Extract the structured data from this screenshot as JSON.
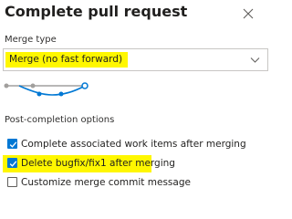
{
  "dialog": {
    "title": "Complete pull request",
    "close_icon": "close-icon"
  },
  "merge_type": {
    "label": "Merge type",
    "selected": "Merge (no fast forward)",
    "dropdown_icon": "chevron-down-icon",
    "highlight_color": "#fff700"
  },
  "post_completion": {
    "label": "Post-completion options",
    "options": [
      {
        "label": "Complete associated work items after merging",
        "checked": true
      },
      {
        "label": "Delete bugfix/fix1 after merging",
        "checked": true
      },
      {
        "label": "Customize merge commit message",
        "checked": false
      }
    ]
  },
  "colors": {
    "accent": "#0078d4",
    "highlight": "#fff700",
    "graph_gray": "#a19f9d"
  }
}
